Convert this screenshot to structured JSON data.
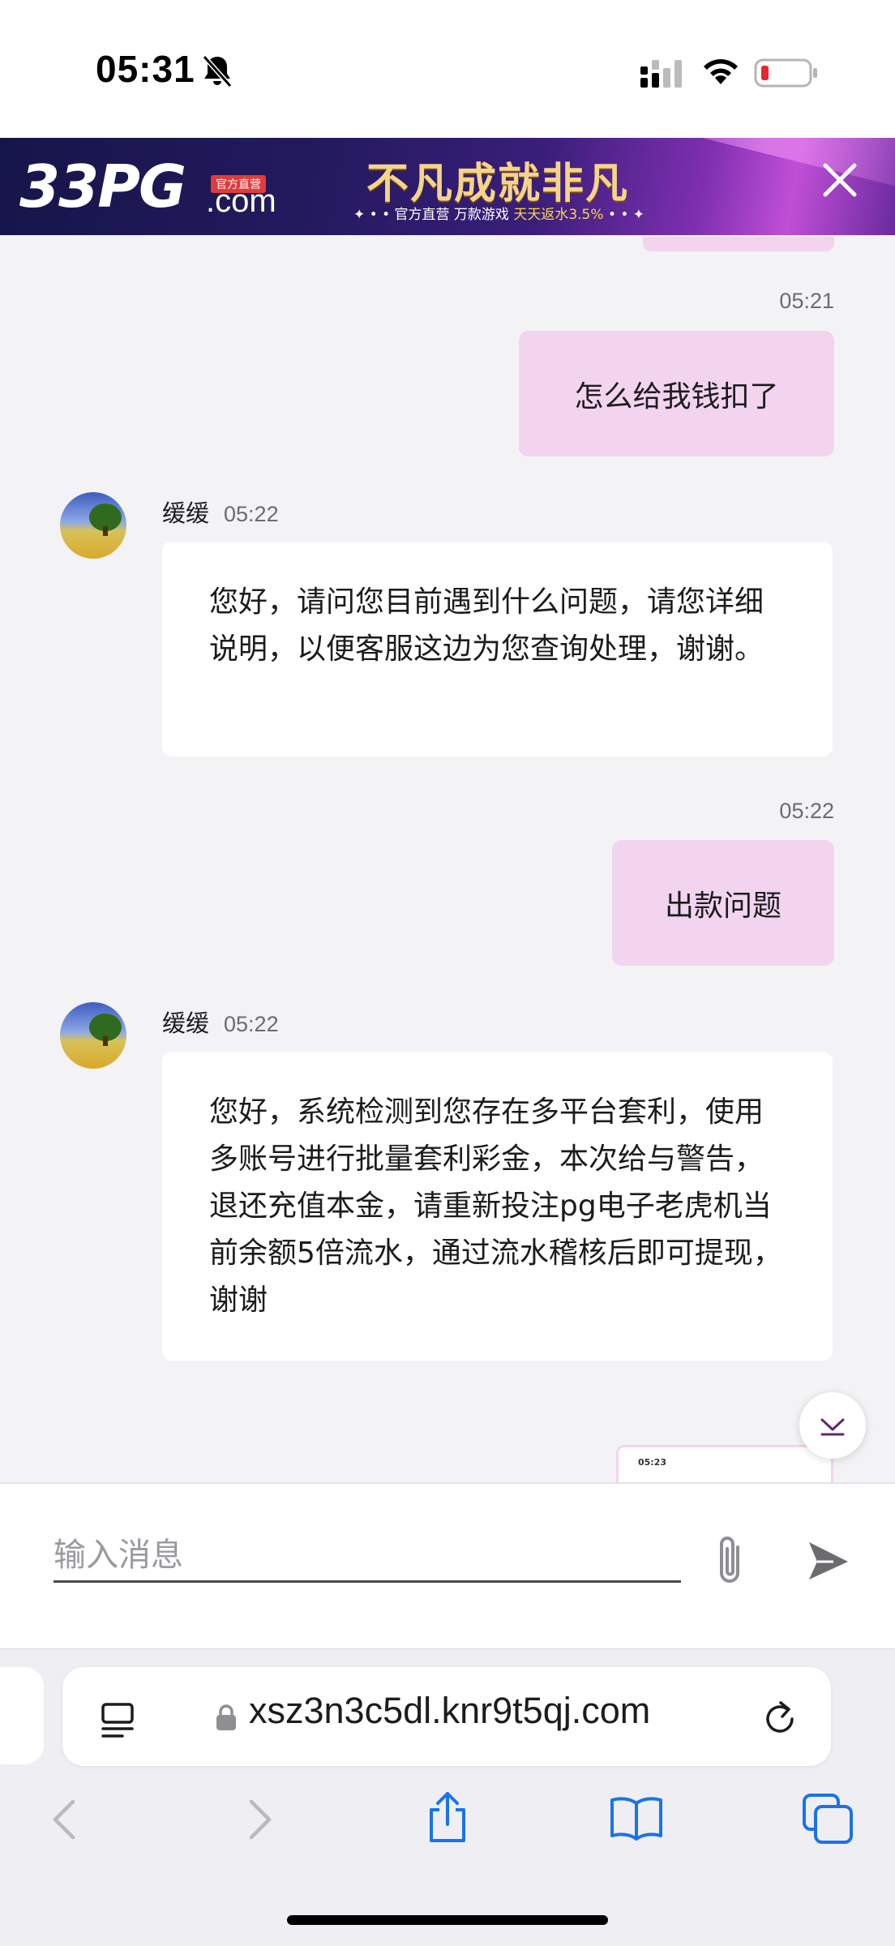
{
  "status_bar": {
    "time": "05:31",
    "icons": [
      "bell-slash-icon",
      "cellular-signal-icon",
      "wifi-icon",
      "battery-low-icon"
    ]
  },
  "ad_banner": {
    "logo": "33PG",
    "logo_domain": ".com",
    "badge": "官方直营",
    "slogan": "不凡成就非凡",
    "sub_prefix": "✦ • • 官方直营  万款游戏",
    "sub_highlight": "天天返水3.5%",
    "sub_suffix": "• • ✦"
  },
  "chat": {
    "messages": [
      {
        "side": "out",
        "time": "05:21",
        "text": "怎么给我钱扣了"
      },
      {
        "side": "in",
        "sender": "缓缓",
        "time": "05:22",
        "text": "您好，请问您目前遇到什么问题，请您详细说明，以便客服这边为您查询处理，谢谢。"
      },
      {
        "side": "out",
        "time": "05:22",
        "text": "出款问题"
      },
      {
        "side": "in",
        "sender": "缓缓",
        "time": "05:22",
        "text": "您好，系统检测到您存在多平台套利，使用多账号进行批量套利彩金，本次给与警告，退还充值本金，请重新投注pg电子老虎机当前余额5倍流水，通过流水稽核后即可提现，谢谢"
      },
      {
        "side": "out",
        "time": "05",
        "image_thumb_time": "05:23"
      }
    ]
  },
  "composer": {
    "placeholder": "输入消息"
  },
  "browser": {
    "url": "xsz3n3c5dl.knr9t5qj.com"
  },
  "colors": {
    "outgoing_bubble": "#f2d4ef",
    "incoming_bubble": "#ffffff",
    "chat_background": "#f3f3f5"
  }
}
